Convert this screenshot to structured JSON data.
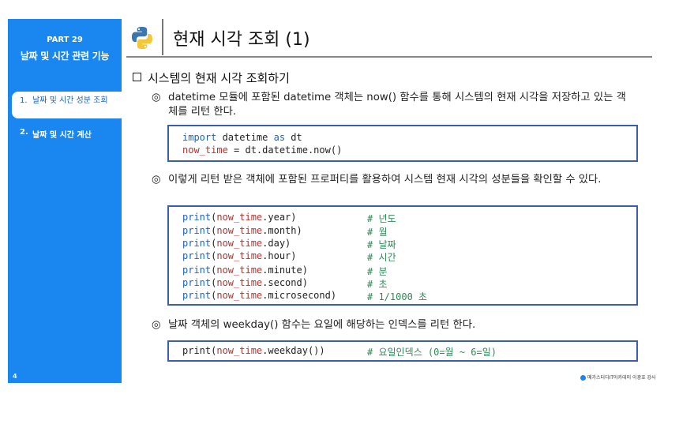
{
  "sidebar": {
    "part_no": "PART 29",
    "part_title": "날짜 및 시간 관련 기능",
    "items": [
      {
        "num": "1.",
        "label": "날짜 및 시간 성분 조회"
      },
      {
        "num": "2.",
        "label": "날짜 및 시간 계산"
      }
    ],
    "page_number": "4"
  },
  "header": {
    "logo_icon": "python-logo-icon",
    "title": "현재 시각 조회 (1)"
  },
  "section": {
    "heading": "시스템의 현재 시각 조회하기",
    "bullet_mark": "◎",
    "bullets": [
      "datetime 모듈에 포함된 datetime 객체는 now() 함수를 통해 시스템의 현재 시각을 저장하고 있는 객체를 리턴 한다.",
      "이렇게 리턴 받은 객체에 포함된 프로퍼티를 활용하여 시스템 현재 시각의 성분들을 확인할 수 있다.",
      "날짜 객체의 weekday() 함수는 요일에 해당하는 인덱스를 리턴 한다."
    ]
  },
  "code1": {
    "line1": {
      "kw_import": "import",
      "mod": " datetime ",
      "kw_as": "as",
      "alias": " dt"
    },
    "line2": {
      "var": "now_time",
      "rest": " = dt.datetime.now()"
    }
  },
  "code2": {
    "lines": [
      {
        "fn": "print",
        "open": "(",
        "var": "now_time",
        "attr": ".year)",
        "comment": "# 년도"
      },
      {
        "fn": "print",
        "open": "(",
        "var": "now_time",
        "attr": ".month)",
        "comment": "# 월"
      },
      {
        "fn": "print",
        "open": "(",
        "var": "now_time",
        "attr": ".day)",
        "comment": "# 날짜"
      },
      {
        "fn": "print",
        "open": "(",
        "var": "now_time",
        "attr": ".hour)",
        "comment": "# 시간"
      },
      {
        "fn": "print",
        "open": "(",
        "var": "now_time",
        "attr": ".minute)",
        "comment": "# 분"
      },
      {
        "fn": "print",
        "open": "(",
        "var": "now_time",
        "attr": ".second)",
        "comment": "# 초"
      },
      {
        "fn": "print",
        "open": "(",
        "var": "now_time",
        "attr": ".microsecond)",
        "comment": "# 1/1000 초"
      }
    ]
  },
  "code3": {
    "fn": "print",
    "open": "(",
    "var": "now_time",
    "attr": ".weekday())",
    "comment": "# 요일인덱스 (0=월 ~ 6=일)"
  },
  "footer": {
    "brand": "메가스터디IT아카데미",
    "instructor": "이광호 강사"
  },
  "colors": {
    "sidebar": "#1a86f0",
    "code_border": "#3a5eb0",
    "keyword": "#1a63c5",
    "variable": "#b5322e",
    "comment": "#2e8b57"
  }
}
